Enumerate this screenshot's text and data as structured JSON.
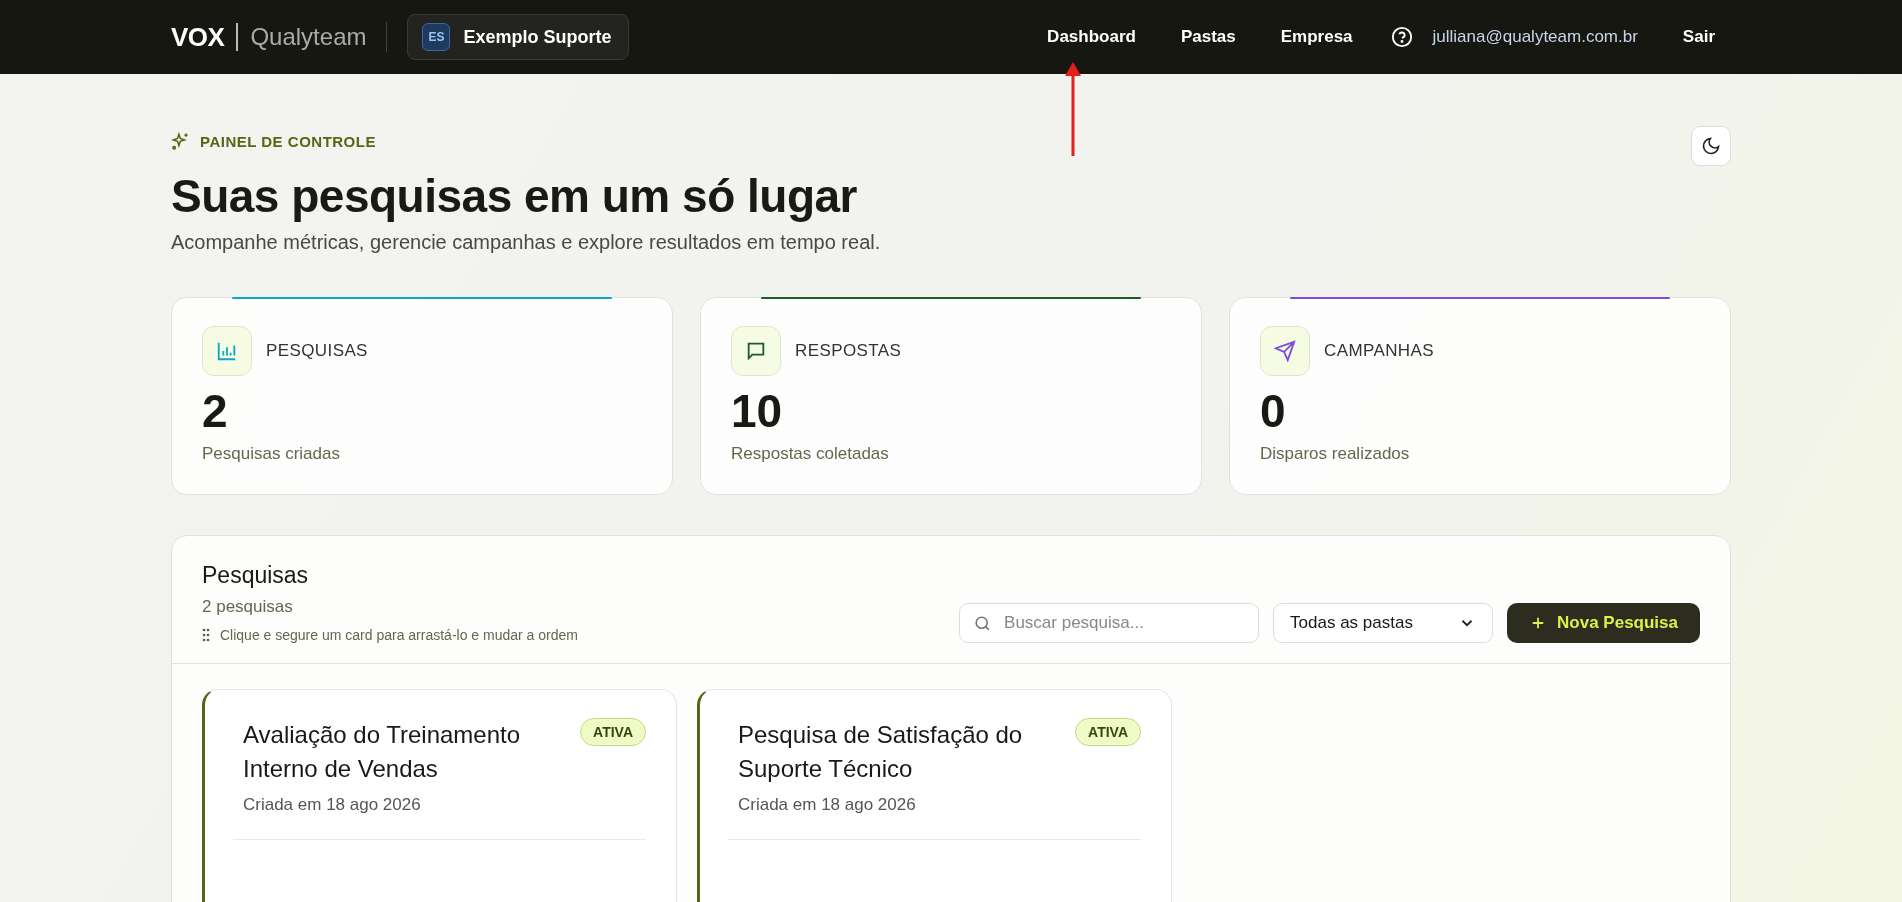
{
  "header": {
    "logo": "VOX",
    "brand": "Qualyteam",
    "workspace": {
      "initials": "ES",
      "name": "Exemplo Suporte"
    },
    "nav": [
      "Dashboard",
      "Pastas",
      "Empresa"
    ],
    "user_email": "julliana@qualyteam.com.br",
    "logout": "Sair"
  },
  "hero": {
    "eyebrow": "PAINEL DE CONTROLE",
    "title": "Suas pesquisas em um só lugar",
    "subtitle": "Acompanhe métricas, gerencie campanhas e explore resultados em tempo real."
  },
  "stats": [
    {
      "kind": "chart",
      "color": "#0ea5c6",
      "label": "PESQUISAS",
      "value": "2",
      "caption": "Pesquisas criadas"
    },
    {
      "kind": "message",
      "color": "#1f5a2e",
      "label": "RESPOSTAS",
      "value": "10",
      "caption": "Respostas coletadas"
    },
    {
      "kind": "send",
      "color": "#7c4ddb",
      "label": "CAMPANHAS",
      "value": "0",
      "caption": "Disparos realizados"
    }
  ],
  "surveys": {
    "title": "Pesquisas",
    "count": "2 pesquisas",
    "hint": "Clique e segure um card para arrastá-lo e mudar a ordem",
    "search": {
      "placeholder": "Buscar pesquisa..."
    },
    "folder_filter": "Todas as pastas",
    "new_button": "Nova Pesquisa",
    "cards": [
      {
        "title": "Avaliação do Treinamento Interno de Vendas",
        "status": "ATIVA",
        "created": "Criada em 18 ago 2026"
      },
      {
        "title": "Pesquisa de Satisfação do Suporte Técnico",
        "status": "ATIVA",
        "created": "Criada em 18 ago 2026"
      }
    ]
  }
}
